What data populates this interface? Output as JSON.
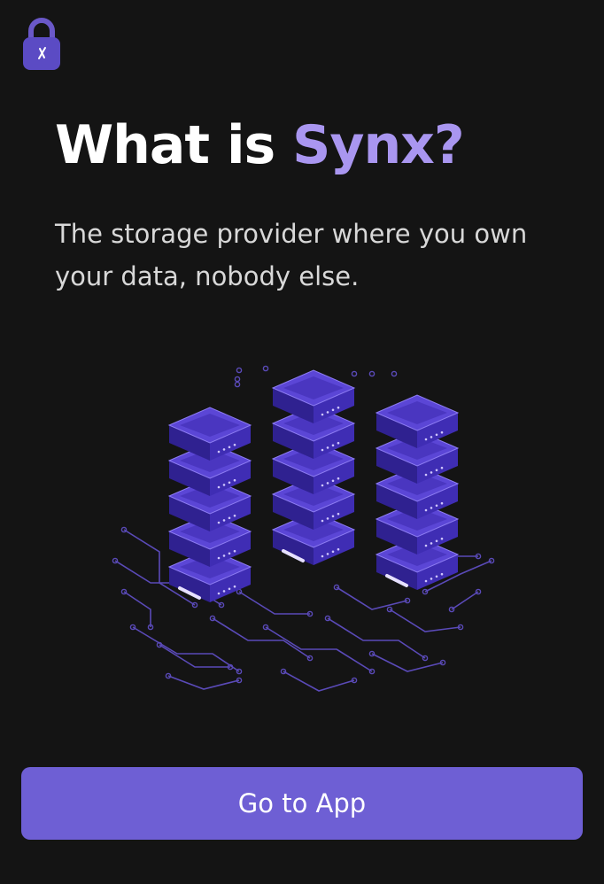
{
  "header": {
    "logo_icon": "lock-icon"
  },
  "hero": {
    "title_prefix": "What is ",
    "title_accent": "Synx?",
    "subtitle": "The storage provider where you own your data, nobody else."
  },
  "illustration": {
    "icon": "server-stack-illustration"
  },
  "actions": {
    "go_to_app_label": "Go to App"
  },
  "colors": {
    "background": "#141414",
    "accent": "#a996f0",
    "button": "#6e5fd4",
    "server_top": "#5b46d6",
    "server_side": "#3d2aa8",
    "circuit": "#5a4ab8"
  }
}
